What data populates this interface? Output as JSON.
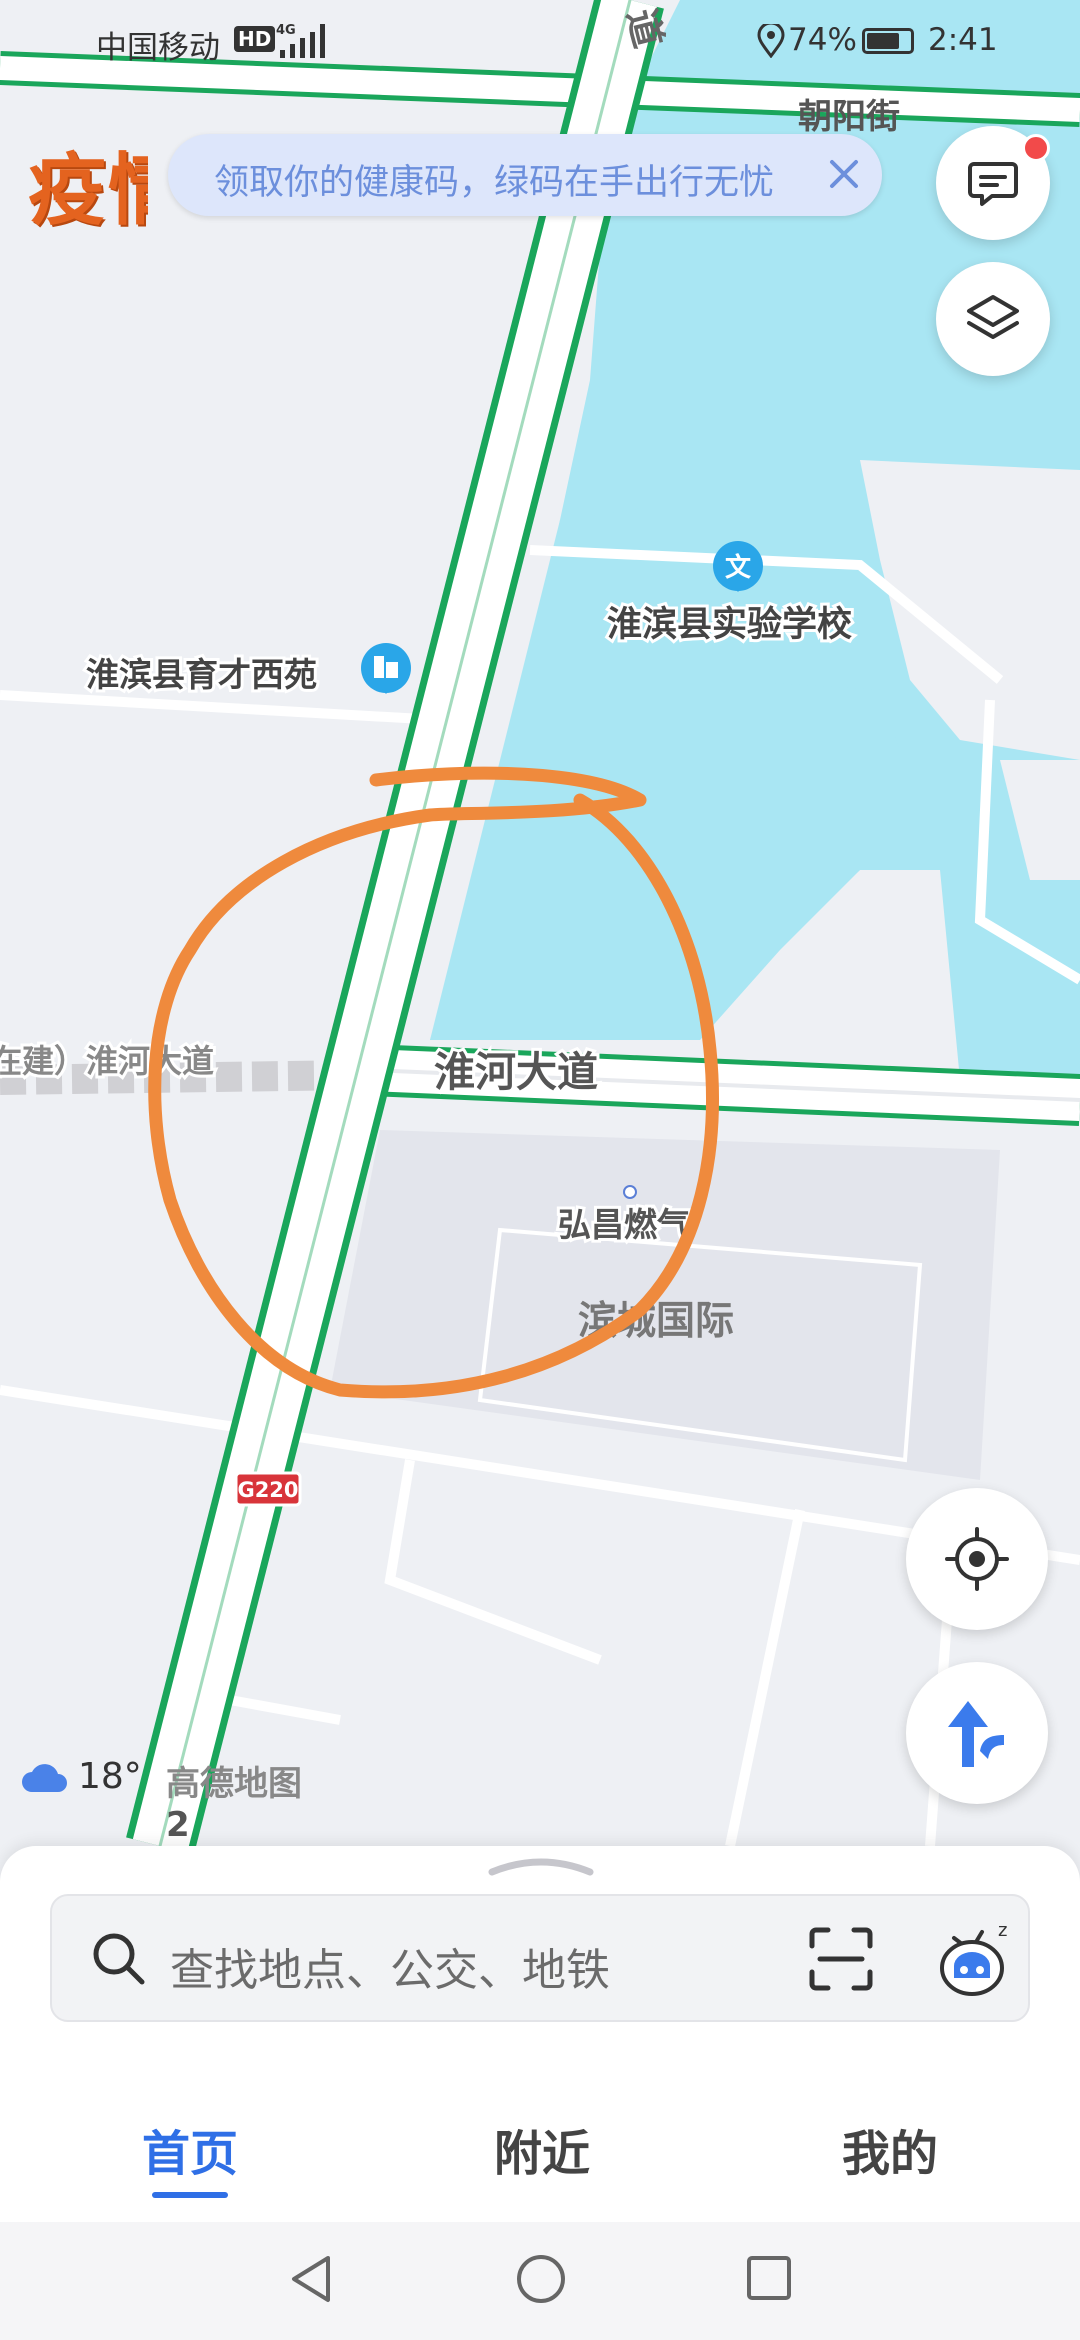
{
  "status_bar": {
    "carrier": "中国移动",
    "hd": "HD",
    "battery": "74%",
    "time": "2:41"
  },
  "banner": {
    "badge": "疫情",
    "text": "领取你的健康码，绿码在手出行无忧"
  },
  "map": {
    "labels": {
      "road_top": "道",
      "chaoyang": "朝阳街",
      "school": "淮滨县实验学校",
      "yucai": "淮滨县育才西苑",
      "huaihe_west": "在建）淮河大道",
      "huaihe": "淮河大道",
      "gas": "弘昌燃气",
      "bincheng": "滨城国际",
      "g220": "G220",
      "number2": "2"
    },
    "colors": {
      "road_green": "#1aa65b",
      "water": "#a9e6f3",
      "annotation": "#ef8a3d",
      "poi_blue": "#2aa6e8"
    }
  },
  "weather": {
    "temperature": "18°",
    "provider": "高德地图"
  },
  "search": {
    "placeholder": "查找地点、公交、地铁"
  },
  "tabs": {
    "home": "首页",
    "nearby": "附近",
    "mine": "我的"
  },
  "icons": {
    "message": "message-icon",
    "layers": "layers-icon",
    "locate": "locate-icon",
    "navigate": "navigation-arrow-icon",
    "search": "search-icon",
    "scan": "scan-icon",
    "assistant": "assistant-icon"
  }
}
